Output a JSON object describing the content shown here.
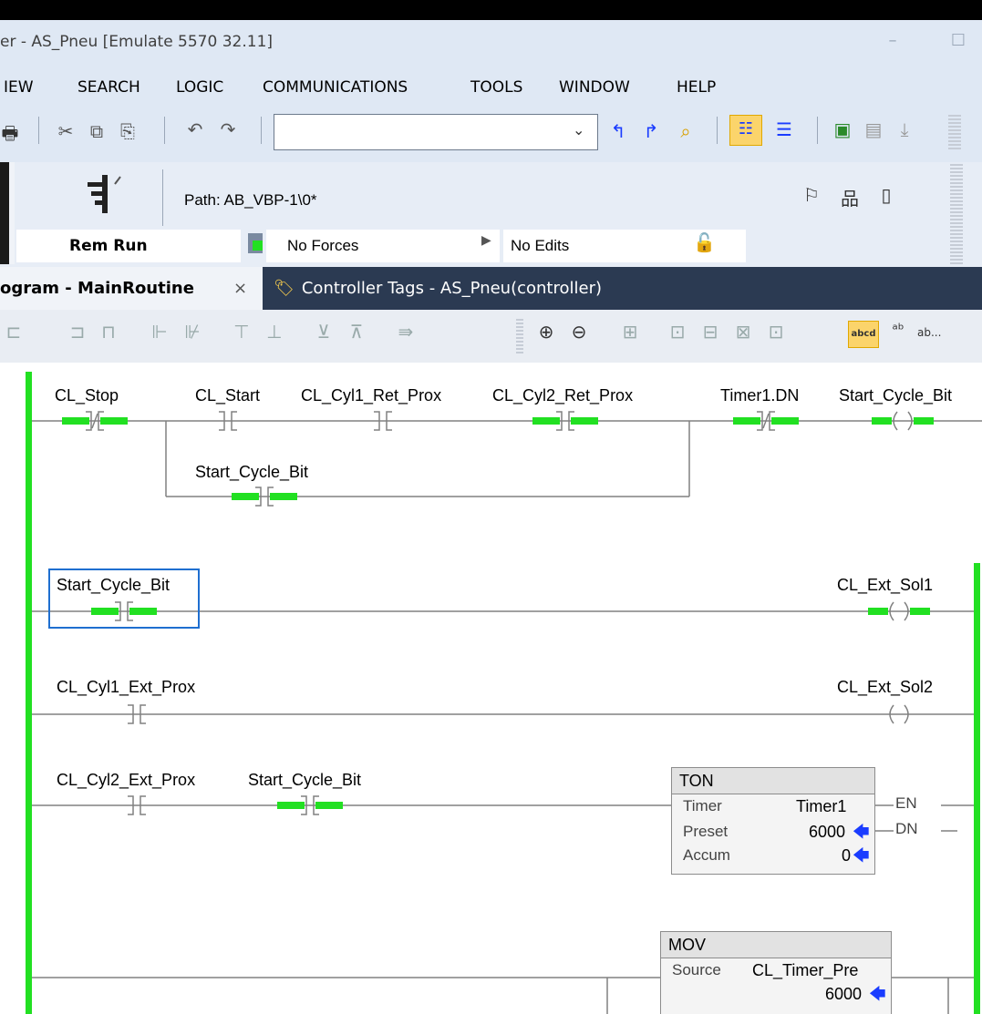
{
  "window": {
    "title": "er - AS_Pneu [Emulate 5570 32.11]",
    "min_glyph": "–",
    "max_glyph": "☐"
  },
  "menu": [
    "IEW",
    "SEARCH",
    "LOGIC",
    "COMMUNICATIONS",
    "TOOLS",
    "WINDOW",
    "HELP"
  ],
  "toolbar": {
    "icons": [
      "print-icon",
      "cut-icon",
      "copy-icon",
      "paste-icon",
      "undo-icon",
      "redo-icon",
      "search-combo",
      "find-icon",
      "replace-icon",
      "browse-icon",
      "tree-icon",
      "tree2-icon",
      "verify-icon",
      "verify2-icon",
      "download-icon"
    ],
    "combo_value": ""
  },
  "status": {
    "path_label": "Path: AB_VBP-1\\0*",
    "mode": "Rem Run",
    "forces": "No Forces",
    "edits": "No Edits"
  },
  "tabs": [
    {
      "label": "ogram - MainRoutine",
      "close": "×",
      "active": true
    },
    {
      "label": "Controller Tags - AS_Pneu(controller)",
      "active": false
    }
  ],
  "ladder_toolbar": {
    "abcd_label": "abcd",
    "ab_label": "ab..."
  },
  "colors": {
    "power_rail": "#22e022",
    "energized": "#22e022",
    "wire": "#808080",
    "selection": "#1f6fd0",
    "tab_bg": "#2b3a52",
    "arrow_blue": "#1a3cff"
  },
  "rungs": [
    {
      "elements": [
        {
          "tag": "CL_Stop",
          "type": "XIO",
          "energized": true
        },
        {
          "tag": "CL_Start",
          "type": "XIC",
          "energized": false
        },
        {
          "tag": "CL_Cyl1_Ret_Prox",
          "type": "XIC",
          "energized": false
        },
        {
          "tag": "CL_Cyl2_Ret_Prox",
          "type": "XIC",
          "energized": true
        },
        {
          "tag": "Timer1.DN",
          "type": "XIO",
          "energized": true
        },
        {
          "tag": "Start_Cycle_Bit",
          "type": "OTE",
          "energized": true
        }
      ],
      "branch": [
        {
          "tag": "Start_Cycle_Bit",
          "type": "XIC",
          "energized": true
        }
      ]
    },
    {
      "elements": [
        {
          "tag": "Start_Cycle_Bit",
          "type": "XIC",
          "energized": true,
          "selected": true
        },
        {
          "tag": "CL_Ext_Sol1",
          "type": "OTE",
          "energized": true
        }
      ]
    },
    {
      "elements": [
        {
          "tag": "CL_Cyl1_Ext_Prox",
          "type": "XIC",
          "energized": false
        },
        {
          "tag": "CL_Ext_Sol2",
          "type": "OTE",
          "energized": false
        }
      ]
    },
    {
      "elements": [
        {
          "tag": "CL_Cyl2_Ext_Prox",
          "type": "XIC",
          "energized": false
        },
        {
          "tag": "Start_Cycle_Bit",
          "type": "XIC",
          "energized": true
        }
      ],
      "ton": {
        "name": "TON",
        "timer_label": "Timer",
        "timer": "Timer1",
        "preset_label": "Preset",
        "preset": "6000",
        "accum_label": "Accum",
        "accum": "0",
        "en": "EN",
        "dn": "DN"
      }
    },
    {
      "mov": {
        "name": "MOV",
        "source_label": "Source",
        "source": "CL_Timer_Pre",
        "source_value": "6000"
      }
    }
  ]
}
